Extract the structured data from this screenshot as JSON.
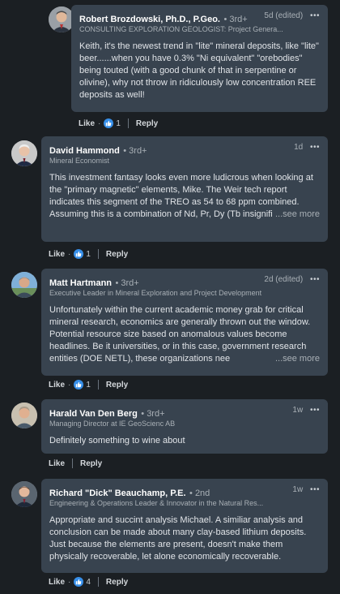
{
  "like_label": "Like",
  "reply_label": "Reply",
  "see_more_label": "...see more",
  "comments": [
    {
      "name": "Robert Brozdowski, Ph.D., P.Geo.",
      "degree": "• 3rd+",
      "time": "5d (edited)",
      "title": "CONSULTING EXPLORATION GEOLOGIST: Project Genera...",
      "body": "Keith, it's the newest trend in \"lite\" mineral deposits, like \"lite\" beer......when you have 0.3% \"Ni equivalent\" \"orebodies\" being touted (with a good chunk of that in serpentine or olivine), why not throw in ridiculously low concentration REE deposits as well!",
      "reactions": "1"
    },
    {
      "name": "David Hammond",
      "degree": "• 3rd+",
      "time": "1d",
      "title": "Mineral Economist",
      "body": "This investment fantasy looks even more ludicrous when looking at the \"primary magnetic\" elements, Mike. The Weir tech report indicates this segment of the TREO as 54 to 68 ppm combined. Assuming this is a combination of Nd, Pr, Dy (Tb insignificant), and using the percentage of oxides of t",
      "reactions": "1"
    },
    {
      "name": "Matt Hartmann",
      "degree": "• 3rd+",
      "time": "2d (edited)",
      "title": "Executive Leader in Mineral Exploration and Project Development",
      "body": "Unfortunately within the current academic money grab for critical mineral research, economics are generally thrown out the window. Potential resource size based on anomalous values become headlines. Be it universities, or in this case, government research entities (DOE NETL), these organizations nee",
      "reactions": "1"
    },
    {
      "name": "Harald Van Den Berg",
      "degree": "• 3rd+",
      "time": "1w",
      "title": "Managing Director at IE GeoScienc AB",
      "body": "Definitely something to wine about",
      "reactions": ""
    },
    {
      "name": "Richard \"Dick\" Beauchamp, P.E.",
      "degree": "• 2nd",
      "time": "1w",
      "title": "Engineering & Operations Leader & Innovator in the Natural Res...",
      "body": "Appropriate and succint analysis Michael. A similiar analysis and conclusion can be made about many clay-based lithium deposits. Just because the elements are present, doesn't make them physically recoverable, let alone economically recoverable.",
      "reactions": "4"
    }
  ]
}
